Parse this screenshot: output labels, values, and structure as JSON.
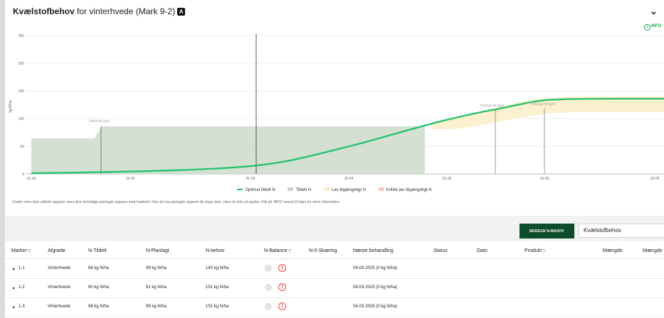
{
  "header": {
    "title_strong": "Kvælstofbehov",
    "title_rest": " for vinterhvede (Mark 9-2)",
    "badge": "A"
  },
  "info_label": "INFO",
  "chart_data": {
    "type": "area",
    "ylabel": "kg N/ha",
    "ylim": [
      0,
      250
    ],
    "y_ticks": [
      "250",
      "200",
      "150",
      "100",
      "50",
      "0"
    ],
    "x_ticks": [
      "01-03",
      "15-03",
      "01-04",
      "15-04",
      "01-05",
      "15-05",
      "29-05"
    ],
    "series": [
      {
        "name": "Optimal tildelt N",
        "color": "#21c36b"
      },
      {
        "name": "Tildelt N",
        "color": "#c6d6c3"
      },
      {
        "name": "Lav tilgængeligt N",
        "color": "#fcedc6"
      },
      {
        "name": "Kritisk lav tilgængeligt N",
        "color": "#f8c7bd"
      }
    ],
    "annotations": [
      {
        "label": "Tildelt 68 kg/N",
        "date": "12-03",
        "value": 86
      },
      {
        "label": "Planlagt 99 kg/N",
        "date": "10-05",
        "value": 123
      },
      {
        "label": "Planlagt 99 kg/N",
        "date": "17-05",
        "value": 127
      }
    ]
  },
  "note": "Grafen viser dine udførte opgaver samt dine fremtidige planlagte opgaver med kvælstof. Hvis du har planlagte opgaver før dags dato, vises de ikke på grafen. Klik på 'INFO' øverst til højre for mere information.",
  "toolbar": {
    "beregn_label": "BEREGN N-BEHOV",
    "select_value": "Kvælstofbehov"
  },
  "table": {
    "columns": [
      "Marker",
      "Afgrøde",
      "N-Tildelt",
      "N-Planlagt",
      "N-behov",
      "N-Balance",
      "N-0-Skæring",
      "Næste behandling",
      "Status",
      "Dato",
      "Produkt",
      "Mængde",
      "Mængde"
    ],
    "filter_icon": "▽",
    "rows": [
      {
        "marker": "1-1",
        "afgrode": "Vinterhvede",
        "tildelt": "68 kg N/ha",
        "planlagt": "99 kg N/ha",
        "behov": "140 kg N/ha",
        "warn": "!",
        "naeste": "04-03-2025 (0 kg N/ha)"
      },
      {
        "marker": "1-2",
        "afgrode": "Vinterhvede",
        "tildelt": "60 kg N/ha",
        "planlagt": "91 kg N/ha",
        "behov": "151 kg N/ha",
        "warn": "!",
        "naeste": "08-03-2025 (0 kg N/ha)"
      },
      {
        "marker": "1-3",
        "afgrode": "Vinterhvede",
        "tildelt": "68 kg N/ha",
        "planlagt": "99 kg N/ha",
        "behov": "151 kg N/ha",
        "warn": "!",
        "naeste": "04-03-2025 (0 kg N/ha)"
      }
    ]
  }
}
